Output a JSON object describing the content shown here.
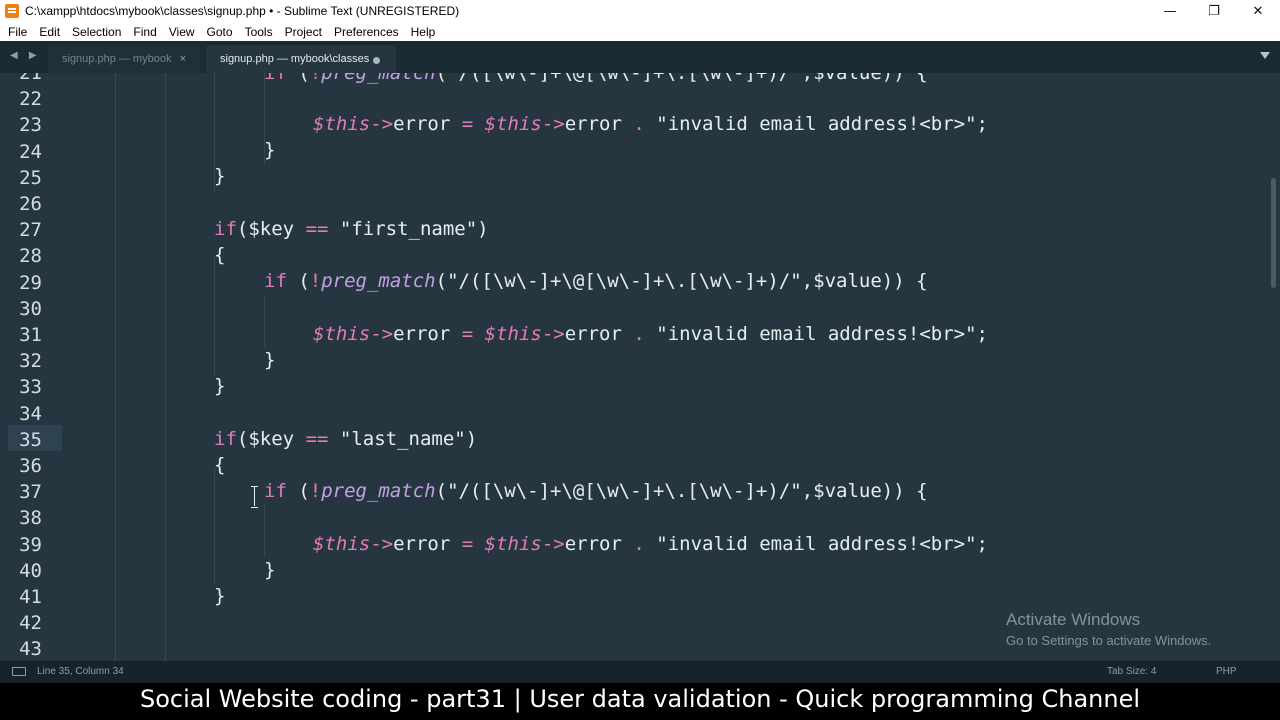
{
  "window": {
    "title": "C:\\xampp\\htdocs\\mybook\\classes\\signup.php • - Sublime Text (UNREGISTERED)",
    "minimize": "—",
    "restore": "❐",
    "close": "✕"
  },
  "menu": [
    "File",
    "Edit",
    "Selection",
    "Find",
    "View",
    "Goto",
    "Tools",
    "Project",
    "Preferences",
    "Help"
  ],
  "tabs": {
    "nav": "◀ ▶",
    "inactive_label": "signup.php — mybook",
    "inactive_close": "×",
    "active_label": "signup.php — mybook\\classes"
  },
  "editor": {
    "line_numbers": [
      "21",
      "22",
      "23",
      "24",
      "25",
      "26",
      "27",
      "28",
      "29",
      "30",
      "31",
      "32",
      "33",
      "34",
      "35",
      "36",
      "37",
      "38",
      "39",
      "40",
      "41",
      "42",
      "43"
    ],
    "highlighted_line": "35"
  },
  "watermark": {
    "title": "Activate Windows",
    "subtitle": "Go to Settings to activate Windows."
  },
  "status": {
    "position": "Line 35, Column 34",
    "tab_size": "Tab Size: 4",
    "syntax": "PHP"
  },
  "caption": "Social Website coding - part31 | User data validation - Quick programming Channel"
}
